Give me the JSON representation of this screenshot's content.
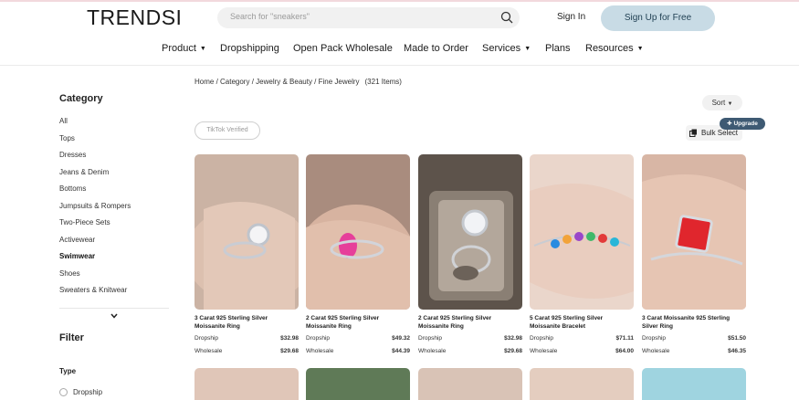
{
  "header": {
    "logo": "TRENDSI",
    "search_placeholder": "Search for \"sneakers\"",
    "signin": "Sign In",
    "signup": "Sign Up for Free"
  },
  "nav": [
    {
      "label": "Product",
      "caret": true
    },
    {
      "label": "Dropshipping",
      "caret": false
    },
    {
      "label": "Open Pack Wholesale",
      "caret": false
    },
    {
      "label": "Made to Order",
      "caret": false
    },
    {
      "label": "Services",
      "caret": true
    },
    {
      "label": "Plans",
      "caret": false
    },
    {
      "label": "Resources",
      "caret": true
    }
  ],
  "sidebar": {
    "title": "Category",
    "categories": [
      "All",
      "Tops",
      "Dresses",
      "Jeans & Denim",
      "Bottoms",
      "Jumpsuits & Rompers",
      "Two-Piece Sets",
      "Activewear",
      "Swimwear",
      "Shoes",
      "Sweaters & Knitwear"
    ],
    "selected": "Swimwear",
    "filter_title": "Filter",
    "type_title": "Type",
    "type_options": [
      "Dropship"
    ]
  },
  "main": {
    "breadcrumb": "Home / Category / Jewelry & Beauty / Fine Jewelry",
    "item_count": "(321 Items)",
    "sort_label": "Sort",
    "tiktok_label": "TikTok Verified",
    "bulk_label": "Bulk Select",
    "upgrade_label": "Upgrade"
  },
  "products": [
    {
      "name": "3 Carat 925 Sterling Silver Moissanite Ring",
      "dropship_label": "Dropship",
      "dropship_price": "$32.98",
      "wholesale_label": "Wholesale",
      "wholesale_price": "$29.68",
      "tone": "#c8a896"
    },
    {
      "name": "2 Carat 925 Sterling Silver Moissanite Ring",
      "dropship_label": "Dropship",
      "dropship_price": "$49.32",
      "wholesale_label": "Wholesale",
      "wholesale_price": "$44.39",
      "tone": "#b8846e"
    },
    {
      "name": "2 Carat 925 Sterling Silver Moissanite Ring",
      "dropship_label": "Dropship",
      "dropship_price": "$32.98",
      "wholesale_label": "Wholesale",
      "wholesale_price": "$29.68",
      "tone": "#7d6f62"
    },
    {
      "name": "5 Carat 925 Sterling Silver Moissanite Bracelet",
      "dropship_label": "Dropship",
      "dropship_price": "$71.11",
      "wholesale_label": "Wholesale",
      "wholesale_price": "$64.00",
      "tone": "#e2c3b2"
    },
    {
      "name": "3 Carat Moissanite 925 Sterling Silver Ring",
      "dropship_label": "Dropship",
      "dropship_price": "$51.50",
      "wholesale_label": "Wholesale",
      "wholesale_price": "$46.35",
      "tone": "#d9b4a2"
    }
  ]
}
